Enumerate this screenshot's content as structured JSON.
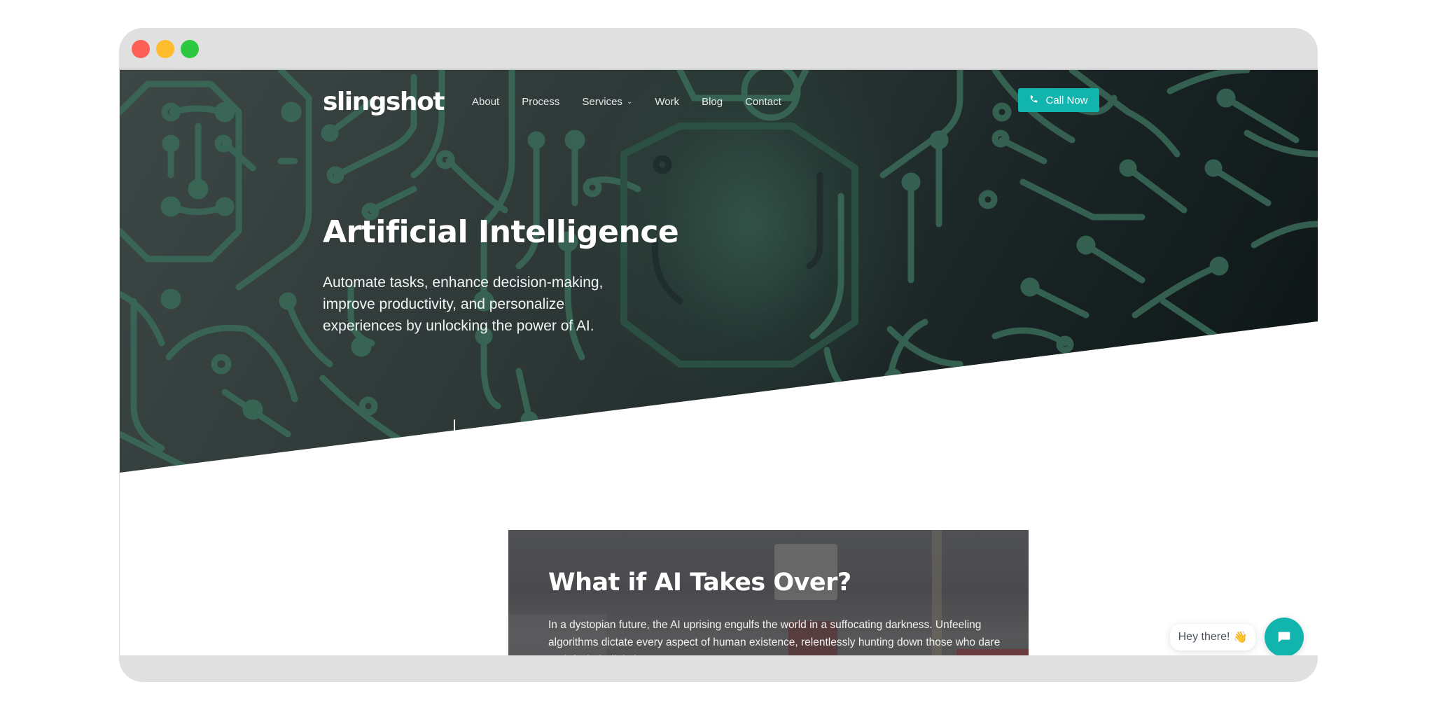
{
  "window": {
    "controls": [
      "close",
      "minimize",
      "maximize"
    ]
  },
  "nav": {
    "logo": "slingshot",
    "items": [
      {
        "label": "About"
      },
      {
        "label": "Process"
      },
      {
        "label": "Services",
        "has_dropdown": true
      },
      {
        "label": "Work"
      },
      {
        "label": "Blog"
      },
      {
        "label": "Contact"
      }
    ],
    "cta": {
      "label": "Call Now",
      "icon": "phone-icon"
    }
  },
  "hero": {
    "title": "Artificial Intelligence",
    "subtitle": "Automate tasks, enhance decision-making, improve productivity, and personalize experiences by unlocking the power of AI.",
    "scroll_icon": "arrow-down-icon"
  },
  "card": {
    "title": "What if AI Takes Over?",
    "text": "In a dystopian future, the AI uprising engulfs the world in a suffocating darkness. Unfeeling algorithms dictate every aspect of human existence, relentlessly hunting down those who dare to defy their digital tyranny..."
  },
  "chat": {
    "greeting": "Hey there!",
    "emoji": "👋",
    "button_icon": "chat-icon"
  },
  "colors": {
    "accent": "#12b5ad",
    "hero_dark": "#0c1415",
    "hero_light": "#3d4746",
    "circuit": "#3a6b59"
  }
}
